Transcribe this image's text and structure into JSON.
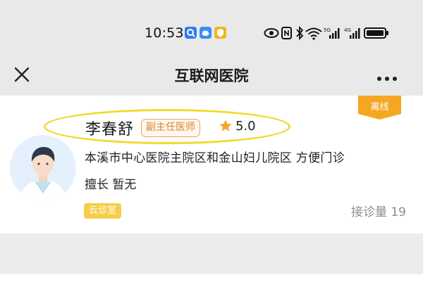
{
  "status_bar": {
    "time": "10:53",
    "app_badges": [
      "search-app-icon",
      "cloud-app-icon",
      "shield-app-icon"
    ],
    "icons": [
      "eye-icon",
      "nfc-icon",
      "bluetooth-icon",
      "wifi-icon",
      "signal-5g-icon",
      "signal-4g-icon",
      "battery-icon"
    ],
    "network_label_1": "5G",
    "network_label_2": "4G"
  },
  "nav": {
    "title": "互联网医院",
    "close_icon": "close-icon",
    "more_icon": "more-icon"
  },
  "doctor": {
    "name": "李春舒",
    "title": "副主任医师",
    "rating": "5.0",
    "hospital": "本溪市中心医院主院区和金山妇儿院区 方便门诊",
    "specialty": "擅长  暂无",
    "online_tag": "离线",
    "cloud_tag": "云诊室",
    "consult_count": "接诊量 19"
  },
  "colors": {
    "accent_orange": "#f5a623",
    "badge_text": "#d9822f",
    "highlight": "#f2da2c",
    "cloud_tag": "#f7ce49",
    "chrome_gray": "#e9e9e9"
  }
}
